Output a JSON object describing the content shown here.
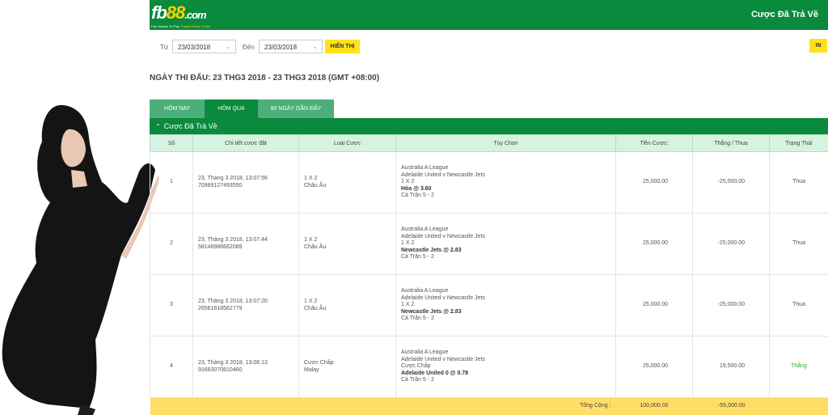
{
  "header": {
    "logo_main": "fb",
    "logo_num": "88",
    "logo_domain": ".com",
    "logo_tagline_a": "Fair Games To Play",
    "logo_tagline_b": "Trusted Place To Bet",
    "title": "Cược Đã Trả Về"
  },
  "filter": {
    "from_label": "Từ",
    "from_date": "23/03/2018",
    "to_label": "Đến",
    "to_date": "23/03/2018",
    "show_button": "HIỂN THỊ",
    "print_button": "IN"
  },
  "match_date": "NGÀY THI ĐẤU: 23 THG3 2018 - 23 THG3 2018 (GMT +08:00)",
  "tabs": [
    "HÔM NAY",
    "HÔM QUA",
    "90 NGÀY GẦN ĐÂY"
  ],
  "section_title": "Cược Đã Trả Về",
  "columns": [
    "Số",
    "Chi tiết cược đặt",
    "Loại Cược",
    "Tùy Chọn",
    "Tiền Cược:",
    "Thắng / Thua",
    "Trạng Thái"
  ],
  "rows": [
    {
      "no": "1",
      "datetime": "23, Tháng 3 2018, 13:07:56",
      "ticket": "70989127493550",
      "type_a": "1 X 2",
      "type_b": "Châu Âu",
      "league": "Australia A League",
      "match": "Adelaide United v Newcastle Jets",
      "market": "1 X 2",
      "pick": "Hòa @ 3.60",
      "score": "Cả Trận 5 - 2",
      "stake": "25,000.00",
      "winloss": "-25,000.00",
      "status": "Thua"
    },
    {
      "no": "2",
      "datetime": "23, Tháng 3 2018, 13:07:44",
      "ticket": "58148986662089",
      "type_a": "1 X 2",
      "type_b": "Châu Âu",
      "league": "Australia A League",
      "match": "Adelaide United v Newcastle Jets",
      "market": "1 X 2",
      "pick": "Newcastle Jets @ 2.83",
      "score": "Cả Trận 5 - 2",
      "stake": "25,000.00",
      "winloss": "-25,000.00",
      "status": "Thua"
    },
    {
      "no": "3",
      "datetime": "23, Tháng 3 2018, 13:07:20",
      "ticket": "26561618562779",
      "type_a": "1 X 2",
      "type_b": "Châu Âu",
      "league": "Australia A League",
      "match": "Adelaide United v Newcastle Jets",
      "market": "1 X 2",
      "pick": "Newcastle Jets @ 2.83",
      "score": "Cả Trận 5 - 2",
      "stake": "25,000.00",
      "winloss": "-25,000.00",
      "status": "Thua"
    },
    {
      "no": "4",
      "datetime": "23, Tháng 3 2018, 13:06:13",
      "ticket": "91683070810460",
      "type_a": "Cược Chấp",
      "type_b": "Malay",
      "league": "Australia A League",
      "match": "Adelaide United v Newcastle Jets",
      "market": "Cược Chấp",
      "pick": "Adelaide United 0 @ 0.78",
      "score": "Cả Trận 5 - 2",
      "stake": "25,000.00",
      "winloss": "19,500.00",
      "status": "Thắng"
    }
  ],
  "total": {
    "label": "Tổng Cộng :",
    "stake": "100,000.00",
    "winloss": "-55,500.00"
  },
  "colors": {
    "brand_green": "#0a8a3c",
    "tab_light_green": "#4caf7a",
    "header_row": "#d6f2e0",
    "button_yellow": "#ffe11a",
    "total_yellow": "#ffdd66",
    "win_green": "#2bab3c"
  }
}
